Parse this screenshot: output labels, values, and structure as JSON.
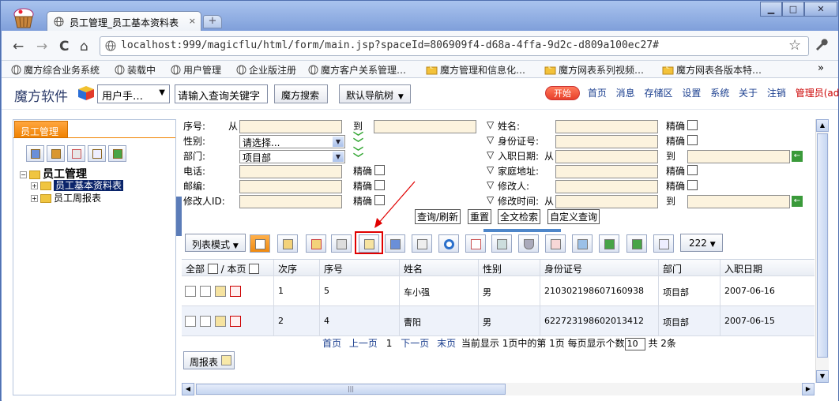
{
  "browser": {
    "tab_title": "员工管理_员工基本资料表",
    "tab_close": "×",
    "new_tab": "+",
    "window": {
      "minimize": "▁",
      "maximize": "□",
      "close": "✕"
    },
    "nav": {
      "back": "←",
      "forward": "→",
      "reload": "C",
      "home": "⌂"
    },
    "address": "localhost:999/magicflu/html/form/main.jsp?spaceId=806909f4-d68a-4ffa-9d2c-d809a100ec27#",
    "star": "☆",
    "wrench": "🔧",
    "bookmarks": [
      "魔方综合业务系统",
      "装载中",
      "用户管理",
      "企业版注册",
      "魔方客户关系管理…",
      "魔方管理和信息化…",
      "魔方网表系列视频…",
      "魔方网表各版本特…"
    ],
    "bookmarks_more": "»"
  },
  "header": {
    "brand": "魔方软件",
    "user_menu": "用户手…",
    "search_placeholder": "请输入查询关键字",
    "search_button": "魔方搜索",
    "nav_button": "默认导航树",
    "start": "开始",
    "links": [
      "首页",
      "消息",
      "存储区",
      "设置",
      "系统",
      "关于",
      "注销"
    ],
    "admin": "管理员(admin)",
    "dropdown_arrow": "▼"
  },
  "left": {
    "tab": "员工管理",
    "tree": {
      "root": "员工管理",
      "children": [
        "员工基本资料表",
        "员工周报表"
      ]
    },
    "expander_plus": "+",
    "expander_minus": "−"
  },
  "filter": {
    "row1": {
      "seq": "序号:",
      "from": "从",
      "to": "到",
      "name": "姓名:",
      "exact": "精确"
    },
    "row2": {
      "gender": "性别:",
      "gender_value": "请选择...",
      "idcard": "身份证号:",
      "exact": "精确"
    },
    "row3": {
      "dept": "部门:",
      "dept_value": "项目部",
      "hire_date": "入职日期:",
      "from": "从",
      "to": "到"
    },
    "row4": {
      "phone": "电话:",
      "exact": "精确",
      "address": "家庭地址:",
      "exact2": "精确"
    },
    "row5": {
      "zip": "邮编:",
      "exact": "精确",
      "modifier": "修改人:",
      "exact2": "精确"
    },
    "row6": {
      "modifier_id": "修改人ID:",
      "exact": "精确",
      "mod_time": "修改时间:",
      "from": "从",
      "to": "到"
    },
    "buttons": [
      "查询/刷新",
      "重置",
      "全文检索",
      "自定义查询"
    ]
  },
  "actions": {
    "list_mode": "列表模式",
    "page_size": "222"
  },
  "grid": {
    "header": {
      "select_all": "全部",
      "slash": "/",
      "this_page": "本页"
    },
    "columns": [
      "次序",
      "序号",
      "姓名",
      "性别",
      "身份证号",
      "部门",
      "入职日期"
    ],
    "rows": [
      [
        "1",
        "5",
        "车小强",
        "男",
        "210302198607160938",
        "项目部",
        "2007-06-16"
      ],
      [
        "2",
        "4",
        "曹阳",
        "男",
        "622723198602013412",
        "项目部",
        "2007-06-15"
      ]
    ]
  },
  "pager": {
    "first": "首页",
    "prev": "上一页",
    "current": "1",
    "next": "下一页",
    "last": "末页",
    "status": "当前显示 1页中的第 1页",
    "per_page_label": "每页显示个数",
    "per_page": "10",
    "total": "共 2条"
  },
  "weekly_button": "周报表",
  "colors": {
    "accent_orange": "#f08200",
    "highlight_red": "#e00000",
    "link_blue": "#1b3f8f",
    "input_bg": "#fcf3de"
  }
}
